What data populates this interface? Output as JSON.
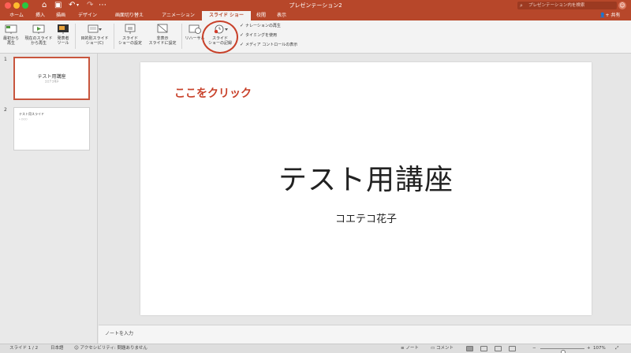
{
  "titlebar": {
    "doc_title": "プレゼンテーション2",
    "search_placeholder": "プレゼンテーション内を検索",
    "home_glyph": "⌂",
    "save_glyph": "▣",
    "undo_glyph": "↶",
    "undo_dropdown_glyph": "▾",
    "redo_glyph": "↷",
    "more_glyph": "⋯",
    "search_glyph": "⌕",
    "avatar_glyph": "☺"
  },
  "tabs": [
    {
      "label": "ホーム",
      "active": false
    },
    {
      "label": "挿入",
      "active": false
    },
    {
      "label": "描画",
      "active": false
    },
    {
      "label": "デザイン",
      "active": false
    },
    {
      "label": "画面切り替え",
      "active": false
    },
    {
      "label": "アニメーション",
      "active": false
    },
    {
      "label": "スライド ショー",
      "active": true
    },
    {
      "label": "校閲",
      "active": false
    },
    {
      "label": "表示",
      "active": false
    }
  ],
  "share_label": "共有",
  "share_glyph": "👤+",
  "ribbon": {
    "from_start": [
      "最初から",
      "再生"
    ],
    "from_current": [
      "現在のスライド",
      "から再生"
    ],
    "presenter": [
      "発表者",
      "ツール"
    ],
    "custom_show": [
      "目的別スライド",
      "ショー(C)"
    ],
    "setup": [
      "スライド",
      "ショーの設定"
    ],
    "hide": [
      "非表示",
      "スライドに設定"
    ],
    "rehearse": "リハーサル",
    "record": [
      "スライド",
      "ショーの記録"
    ],
    "checkboxes": [
      {
        "label": "ナレーションの再生",
        "checked": true
      },
      {
        "label": "タイミングを使用",
        "checked": true
      },
      {
        "label": "メディア コントロールの表示",
        "checked": true
      }
    ],
    "check_glyph": "✓"
  },
  "annotation": {
    "text": "ここをクリック",
    "color": "#c8412a"
  },
  "thumbnails": [
    {
      "number": "1",
      "title": "テスト用講座",
      "subtitle": "コエテコ花子",
      "selected": true
    },
    {
      "number": "2",
      "title": "テスト用スライド",
      "subtitle": "• ○○○",
      "selected": false
    }
  ],
  "slide": {
    "title": "テスト用講座",
    "subtitle": "コエテコ花子"
  },
  "notes_placeholder": "ノートを入力",
  "status": {
    "slide_count": "スライド 1 / 2",
    "language": "日本語",
    "accessibility": "アクセシビリティ: 問題ありません",
    "notes_label": "ノート",
    "comments_label": "コメント",
    "zoom": "107%",
    "zoom_minus": "−",
    "zoom_plus": "+",
    "accessibility_glyph": "☺",
    "notes_glyph": "≡",
    "comments_glyph": "▭",
    "fit_glyph": "⤢"
  },
  "colors": {
    "brand": "#b7472a",
    "selected_thumb_border": "#c8553d"
  }
}
